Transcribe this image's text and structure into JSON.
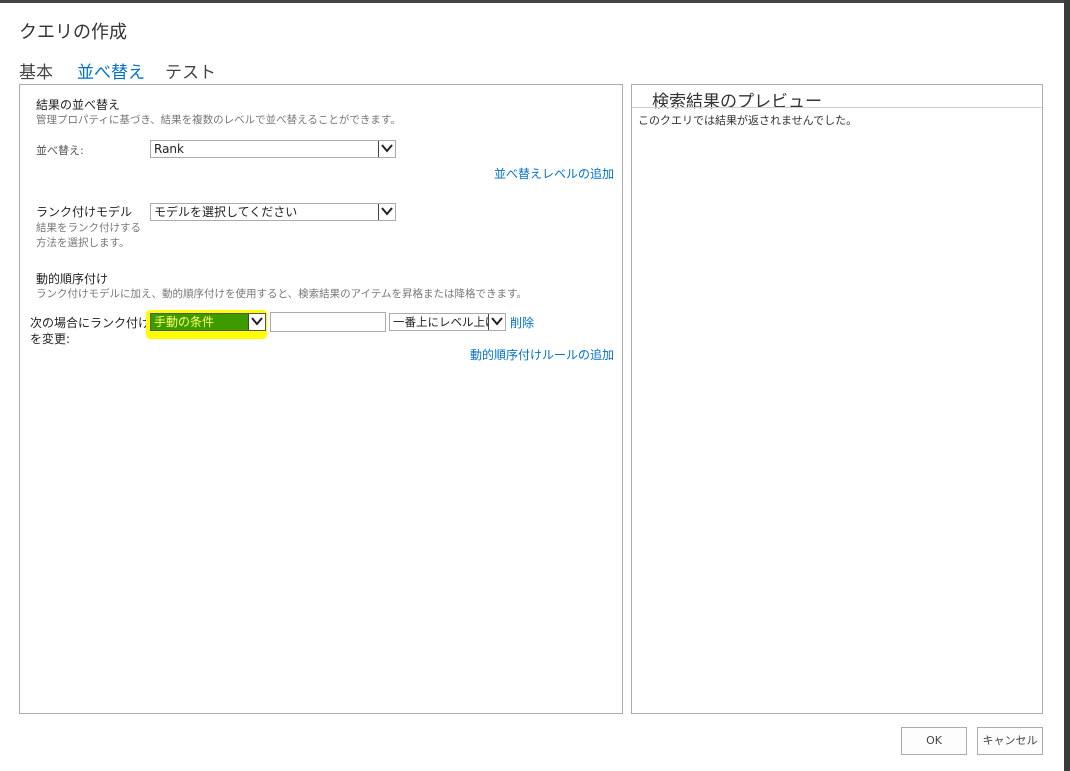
{
  "dialog": {
    "title": "クエリの作成"
  },
  "tabs": [
    {
      "label": "基本"
    },
    {
      "label": "並べ替え"
    },
    {
      "label": "テスト"
    }
  ],
  "sort_section": {
    "title": "結果の並べ替え",
    "description": "管理プロパティに基づき、結果を複数のレベルで並べ替えることができます。",
    "sort_label": "並べ替え:",
    "sort_value": "Rank",
    "add_level_link": "並べ替えレベルの追加"
  },
  "ranking_section": {
    "title": "ランク付けモデル",
    "desc_line1": "結果をランク付けする",
    "desc_line2": "方法を選択します。",
    "model_value": "モデルを選択してください"
  },
  "dynamic_section": {
    "title": "動的順序付け",
    "description": "ランク付けモデルに加え、動的順序付けを使用すると、検索結果のアイテムを昇格または降格できます。",
    "rule_label_line1": "次の場合にランク付け",
    "rule_label_line2": "を変更:",
    "condition_value": "手動の条件",
    "condition_input_value": "",
    "action_value": "一番上にレベル上げ",
    "delete_link": "削除",
    "add_rule_link": "動的順序付けルールの追加"
  },
  "preview": {
    "title": "検索結果のプレビュー",
    "message": "このクエリでは結果が返されませんでした。"
  },
  "footer": {
    "ok_label": "OK",
    "cancel_label": "キャンセル"
  },
  "colors": {
    "link": "#0072c6",
    "highlight": "#ffff00",
    "condition_bg": "#3d9b00"
  }
}
